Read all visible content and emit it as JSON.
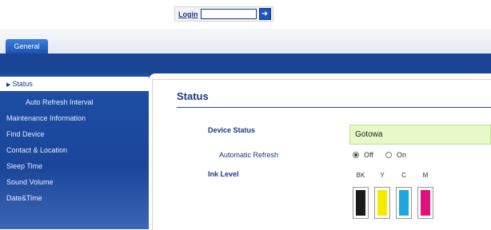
{
  "header": {
    "login_label": "Login",
    "login_value": ""
  },
  "tabs": [
    {
      "label": "General"
    }
  ],
  "sidebar": {
    "items": [
      {
        "label": "Status",
        "active": true
      },
      {
        "label": "Auto Refresh Interval"
      },
      {
        "label": "Maintenance Information"
      },
      {
        "label": "Find Device"
      },
      {
        "label": "Contact & Location"
      },
      {
        "label": "Sleep Time"
      },
      {
        "label": "Sound Volume"
      },
      {
        "label": "Date&Time"
      }
    ]
  },
  "main": {
    "title": "Status",
    "device_status_label": "Device Status",
    "device_status_value": "Gotowa",
    "auto_refresh_label": "Automatic Refresh",
    "auto_refresh_off": "Off",
    "auto_refresh_on": "On",
    "auto_refresh_selected": "Off",
    "ink_level_label": "Ink Level",
    "inks": [
      {
        "name": "BK",
        "color": "#1a1a1a"
      },
      {
        "name": "Y",
        "color": "#f5ea00"
      },
      {
        "name": "C",
        "color": "#1ea7dc"
      },
      {
        "name": "M",
        "color": "#e0107f"
      }
    ]
  },
  "colors": {
    "accent": "#1a4494",
    "status_bg": "#e7f9c9"
  },
  "icons": {
    "login_go": "arrow-right-icon",
    "nav_marker": "triangle-right-icon"
  }
}
